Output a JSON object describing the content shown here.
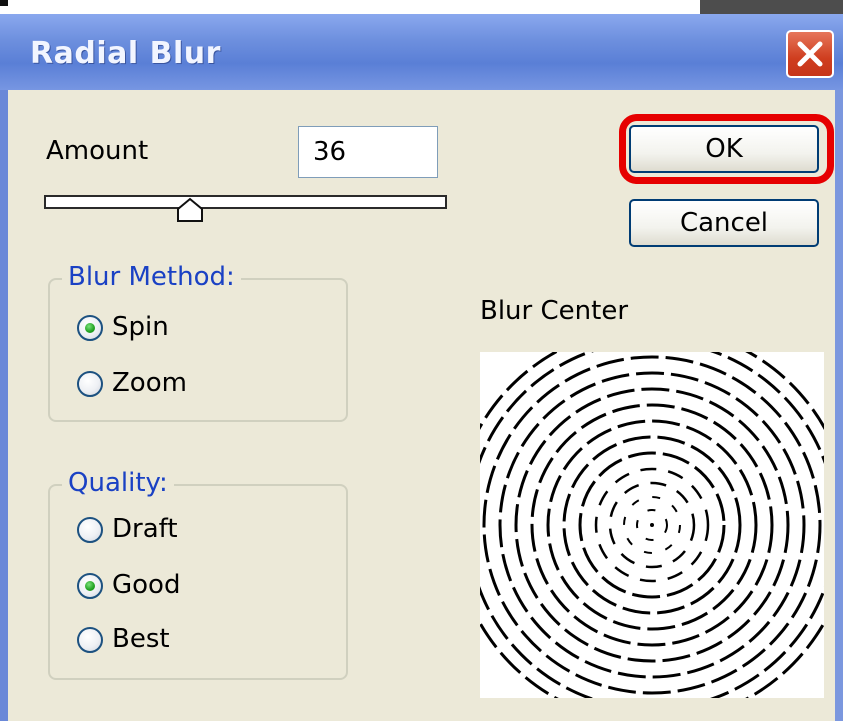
{
  "dialog": {
    "title": "Radial Blur"
  },
  "amount": {
    "label": "Amount",
    "value": "36",
    "slider_fraction": 0.36
  },
  "blur_method": {
    "legend": "Blur Method:",
    "options": [
      {
        "label": "Spin",
        "selected": true
      },
      {
        "label": "Zoom",
        "selected": false
      }
    ]
  },
  "quality": {
    "legend": "Quality:",
    "options": [
      {
        "label": "Draft",
        "selected": false
      },
      {
        "label": "Good",
        "selected": true
      },
      {
        "label": "Best",
        "selected": false
      }
    ]
  },
  "buttons": {
    "ok_label": "OK",
    "cancel_label": "Cancel"
  },
  "preview": {
    "label": "Blur Center"
  },
  "colors": {
    "title_bar": "#6d8fde",
    "dialog_bg": "#ece9d8",
    "legend_text": "#1a41c4",
    "highlight": "#e60000",
    "close_button": "#cf3e1f",
    "radio_dot": "#21a121"
  },
  "icons": {
    "close": "close-icon",
    "slider_thumb": "slider-thumb-icon"
  }
}
